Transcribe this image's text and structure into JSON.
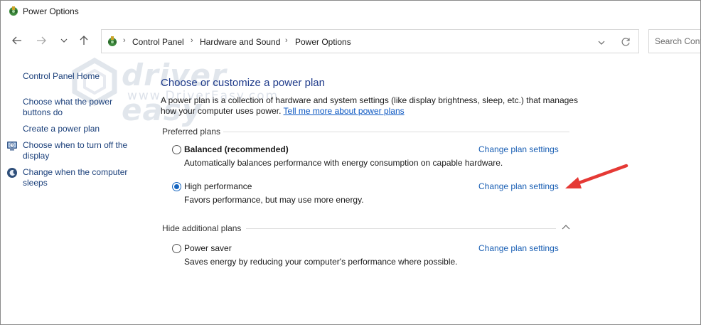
{
  "window": {
    "title": "Power Options",
    "app_icon": "power-options-icon"
  },
  "nav": {
    "back_icon": "arrow-left-icon",
    "forward_icon": "arrow-right-icon",
    "recent_icon": "chevron-down-icon",
    "up_icon": "arrow-up-icon"
  },
  "address": {
    "breadcrumbs": [
      "Control Panel",
      "Hardware and Sound",
      "Power Options"
    ],
    "separator": "›",
    "dropdown_icon": "chevron-down-icon",
    "refresh_icon": "refresh-icon"
  },
  "search": {
    "placeholder": "Search Control Panel"
  },
  "left_pane": {
    "home": "Control Panel Home",
    "links": [
      {
        "label_line1": "Choose what the power",
        "label_line2": "buttons do",
        "icon": ""
      },
      {
        "label_line1": "Create a power plan",
        "label_line2": "",
        "icon": ""
      },
      {
        "label_line1": "Choose when to turn off the",
        "label_line2": "display",
        "icon": "display-clock-icon"
      },
      {
        "label_line1": "Change when the computer",
        "label_line2": "sleeps",
        "icon": "sleep-moon-icon"
      }
    ]
  },
  "watermark": {
    "brand": "driver easy",
    "url": "www.DriverEasy.com"
  },
  "main": {
    "heading": "Choose or customize a power plan",
    "description": "A power plan is a collection of hardware and system settings (like display brightness, sleep, etc.) that manages how your computer uses power.",
    "tell_more": "Tell me more about power plans",
    "preferred_title": "Preferred plans",
    "hidden_title": "Hide additional plans",
    "change_link": "Change plan settings",
    "plans": [
      {
        "name": "Balanced (recommended)",
        "desc": "Automatically balances performance with energy consumption on capable hardware.",
        "selected": false
      },
      {
        "name": "High performance",
        "desc": "Favors performance, but may use more energy.",
        "selected": true
      },
      {
        "name": "Power saver",
        "desc": "Saves energy by reducing your computer's performance where possible.",
        "selected": false
      }
    ]
  },
  "colors": {
    "accent": "#1565c0",
    "link": "#1a5fb4",
    "heading": "#1e3a8a",
    "annotation_arrow": "#e53935"
  }
}
